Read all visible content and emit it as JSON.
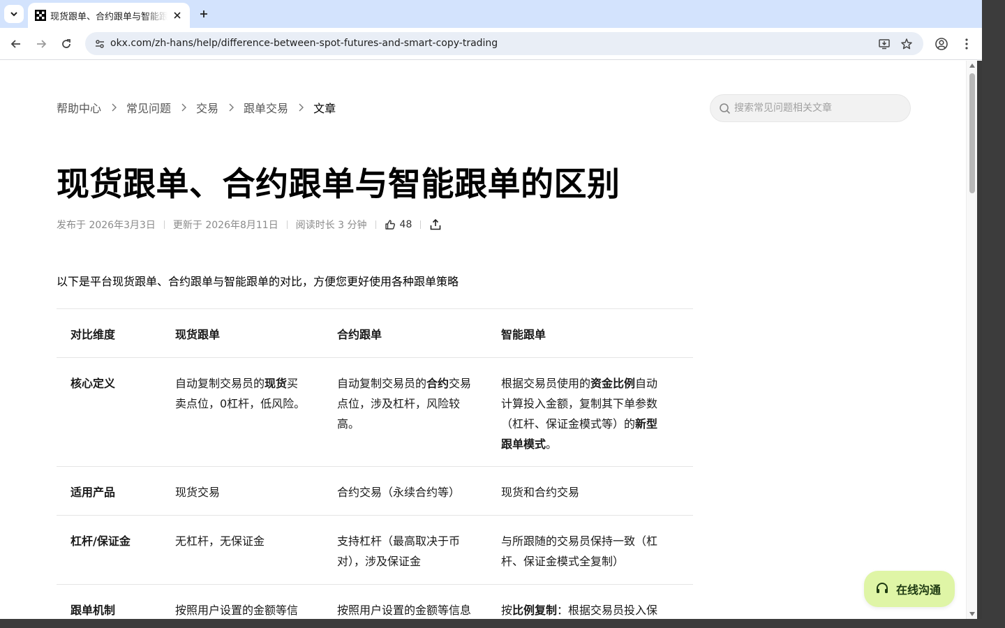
{
  "browser": {
    "tab_title": "现货跟单、合约跟单与智能跟单的区别",
    "url": "okx.com/zh-hans/help/difference-between-spot-futures-and-smart-copy-trading"
  },
  "breadcrumb": {
    "items": [
      "帮助中心",
      "常见问题",
      "交易",
      "跟单交易",
      "文章"
    ]
  },
  "search": {
    "placeholder": "搜索常见问题相关文章"
  },
  "article": {
    "title": "现货跟单、合约跟单与智能跟单的区别",
    "published": "发布于 2026年3月3日",
    "updated": "更新于 2026年8月11日",
    "read_time": "阅读时长 3 分钟",
    "likes": "48",
    "intro": "以下是平台现货跟单、合约跟单与智能跟单的对比，方便您更好使用各种跟单策略"
  },
  "table": {
    "headers": [
      "对比维度",
      "现货跟单",
      "合约跟单",
      "智能跟单"
    ],
    "rows": [
      {
        "dimension": "核心定义",
        "spot": [
          {
            "t": "自动复制交易员的"
          },
          {
            "t": "现货",
            "b": true
          },
          {
            "t": "买卖点位，0杠杆，低风险。"
          }
        ],
        "futures": [
          {
            "t": "自动复制交易员的"
          },
          {
            "t": "合约",
            "b": true
          },
          {
            "t": "交易点位，涉及杠杆，风险较高。"
          }
        ],
        "smart": [
          {
            "t": "根据交易员使用的"
          },
          {
            "t": "资金比例",
            "b": true
          },
          {
            "t": "自动计算投入金额，复制其下单参数（杠杆、保证金模式等）的"
          },
          {
            "t": "新型跟单模式",
            "b": true
          },
          {
            "t": "。"
          }
        ]
      },
      {
        "dimension": "适用产品",
        "spot": [
          {
            "t": "现货交易"
          }
        ],
        "futures": [
          {
            "t": "合约交易（永续合约等）"
          }
        ],
        "smart": [
          {
            "t": "现货和合约交易"
          }
        ]
      },
      {
        "dimension": "杠杆/保证金",
        "spot": [
          {
            "t": "无杠杆，无保证金"
          }
        ],
        "futures": [
          {
            "t": "支持杠杆（最高取决于币对），涉及保证金"
          }
        ],
        "smart": [
          {
            "t": "与所跟随的交易员保持一致（杠杆、保证金模式全复制）"
          }
        ]
      },
      {
        "dimension": "跟单机制",
        "spot": [
          {
            "t": "按照用户设置的金额等信"
          }
        ],
        "futures": [
          {
            "t": "按照用户设置的金额等信息"
          }
        ],
        "smart": [
          {
            "t": "按"
          },
          {
            "t": "比例复制",
            "b": true
          },
          {
            "t": "：根据交易员投入保证"
          }
        ]
      }
    ]
  },
  "chat": {
    "label": "在线沟通"
  },
  "colors": {
    "tabstrip": "#d3e3fd",
    "omnibox": "#e9eef6",
    "chat_bg": "#dff5a6",
    "chat_text": "#1e3a12"
  }
}
